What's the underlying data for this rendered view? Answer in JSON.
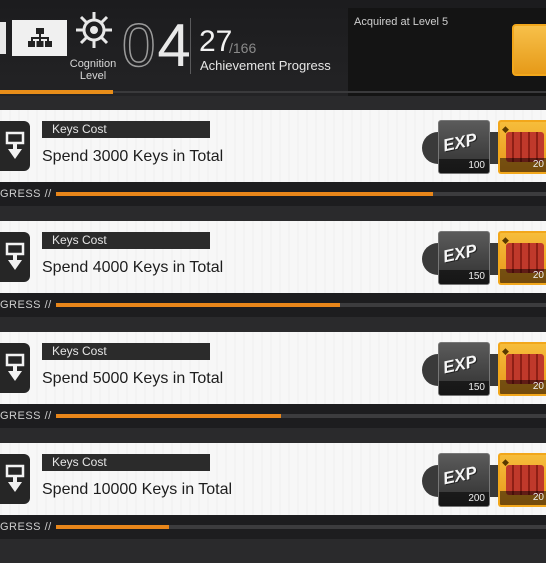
{
  "header": {
    "cognition_label": "Cognition Level",
    "level_prefix": "0",
    "level_value": "4",
    "achievement_done": "27",
    "achievement_total": "/166",
    "achievement_label": "Achievement Progress",
    "reward_note": "Acquired at Level 5",
    "accent_color": "#e88d19"
  },
  "achievements": [
    {
      "category": "Keys Cost",
      "title": "Spend 3000 Keys in Total",
      "exp_label": "EXP",
      "exp_qty": "100",
      "box_qty": "20",
      "progress_label": "GRESS //",
      "progress": 0.77
    },
    {
      "category": "Keys Cost",
      "title": "Spend 4000 Keys in Total",
      "exp_label": "EXP",
      "exp_qty": "150",
      "box_qty": "20",
      "progress_label": "GRESS //",
      "progress": 0.58
    },
    {
      "category": "Keys Cost",
      "title": "Spend 5000 Keys in Total",
      "exp_label": "EXP",
      "exp_qty": "150",
      "box_qty": "20",
      "progress_label": "GRESS //",
      "progress": 0.46
    },
    {
      "category": "Keys Cost",
      "title": "Spend 10000 Keys in Total",
      "exp_label": "EXP",
      "exp_qty": "200",
      "box_qty": "20",
      "progress_label": "GRESS //",
      "progress": 0.23
    }
  ]
}
